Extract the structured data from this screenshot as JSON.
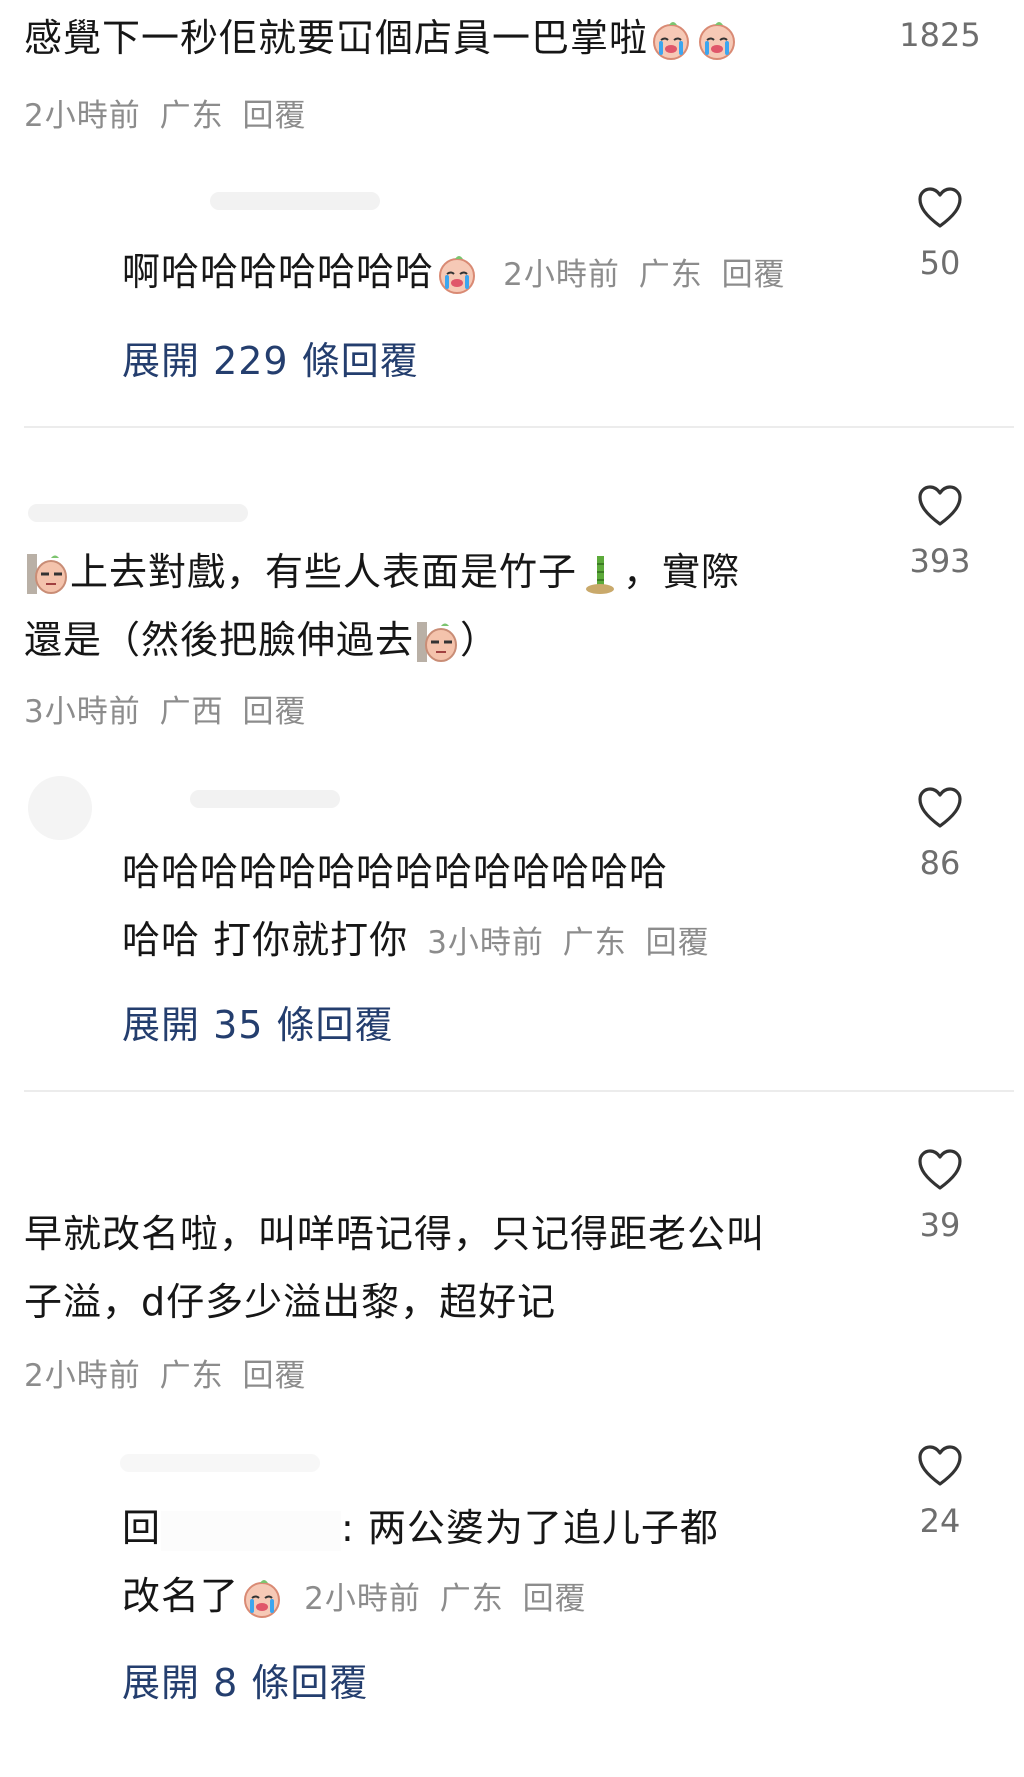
{
  "comments": [
    {
      "text": "感覺下一秒佢就要冚個店員一巴掌啦",
      "time": "2小時前",
      "region": "广东",
      "reply_label": "回覆",
      "likes": "1825"
    },
    {
      "text": "啊哈哈哈哈哈哈哈",
      "time": "2小時前",
      "region": "广东",
      "reply_label": "回覆",
      "likes": "50",
      "expand": "展開 229 條回覆"
    },
    {
      "text_a": "上去對戲，有些人表面是竹子",
      "text_b": "，實際",
      "text_c": "還是（然後把臉伸過去",
      "text_d": "）",
      "time": "3小時前",
      "region": "广西",
      "reply_label": "回覆",
      "likes": "393"
    },
    {
      "text_a": "哈哈哈哈哈哈哈哈哈哈哈哈哈哈",
      "text_b": "哈哈 打你就打你",
      "time": "3小時前",
      "region": "广东",
      "reply_label": "回覆",
      "likes": "86",
      "expand": "展開 35 條回覆"
    },
    {
      "text_a": "早就改名啦，叫咩唔记得，只记得距老公叫",
      "text_b": "子溢，d仔多少溢出黎，超好记",
      "time": "2小時前",
      "region": "广东",
      "reply_label": "回覆",
      "likes": "39"
    },
    {
      "prefix": "回",
      "text_a": ": 两公婆为了追儿子都",
      "text_b": "改名了",
      "time": "2小時前",
      "region": "广东",
      "reply_label": "回覆",
      "likes": "24",
      "expand": "展開 8 條回覆"
    }
  ],
  "icons": {
    "like": "heart-outline-icon",
    "crying": "crying-face-icon",
    "peeking": "peeking-face-icon",
    "bamboo": "bamboo-icon"
  },
  "colors": {
    "expand_link": "#243e6e",
    "meta": "#8c8c8c",
    "text": "#161616"
  }
}
